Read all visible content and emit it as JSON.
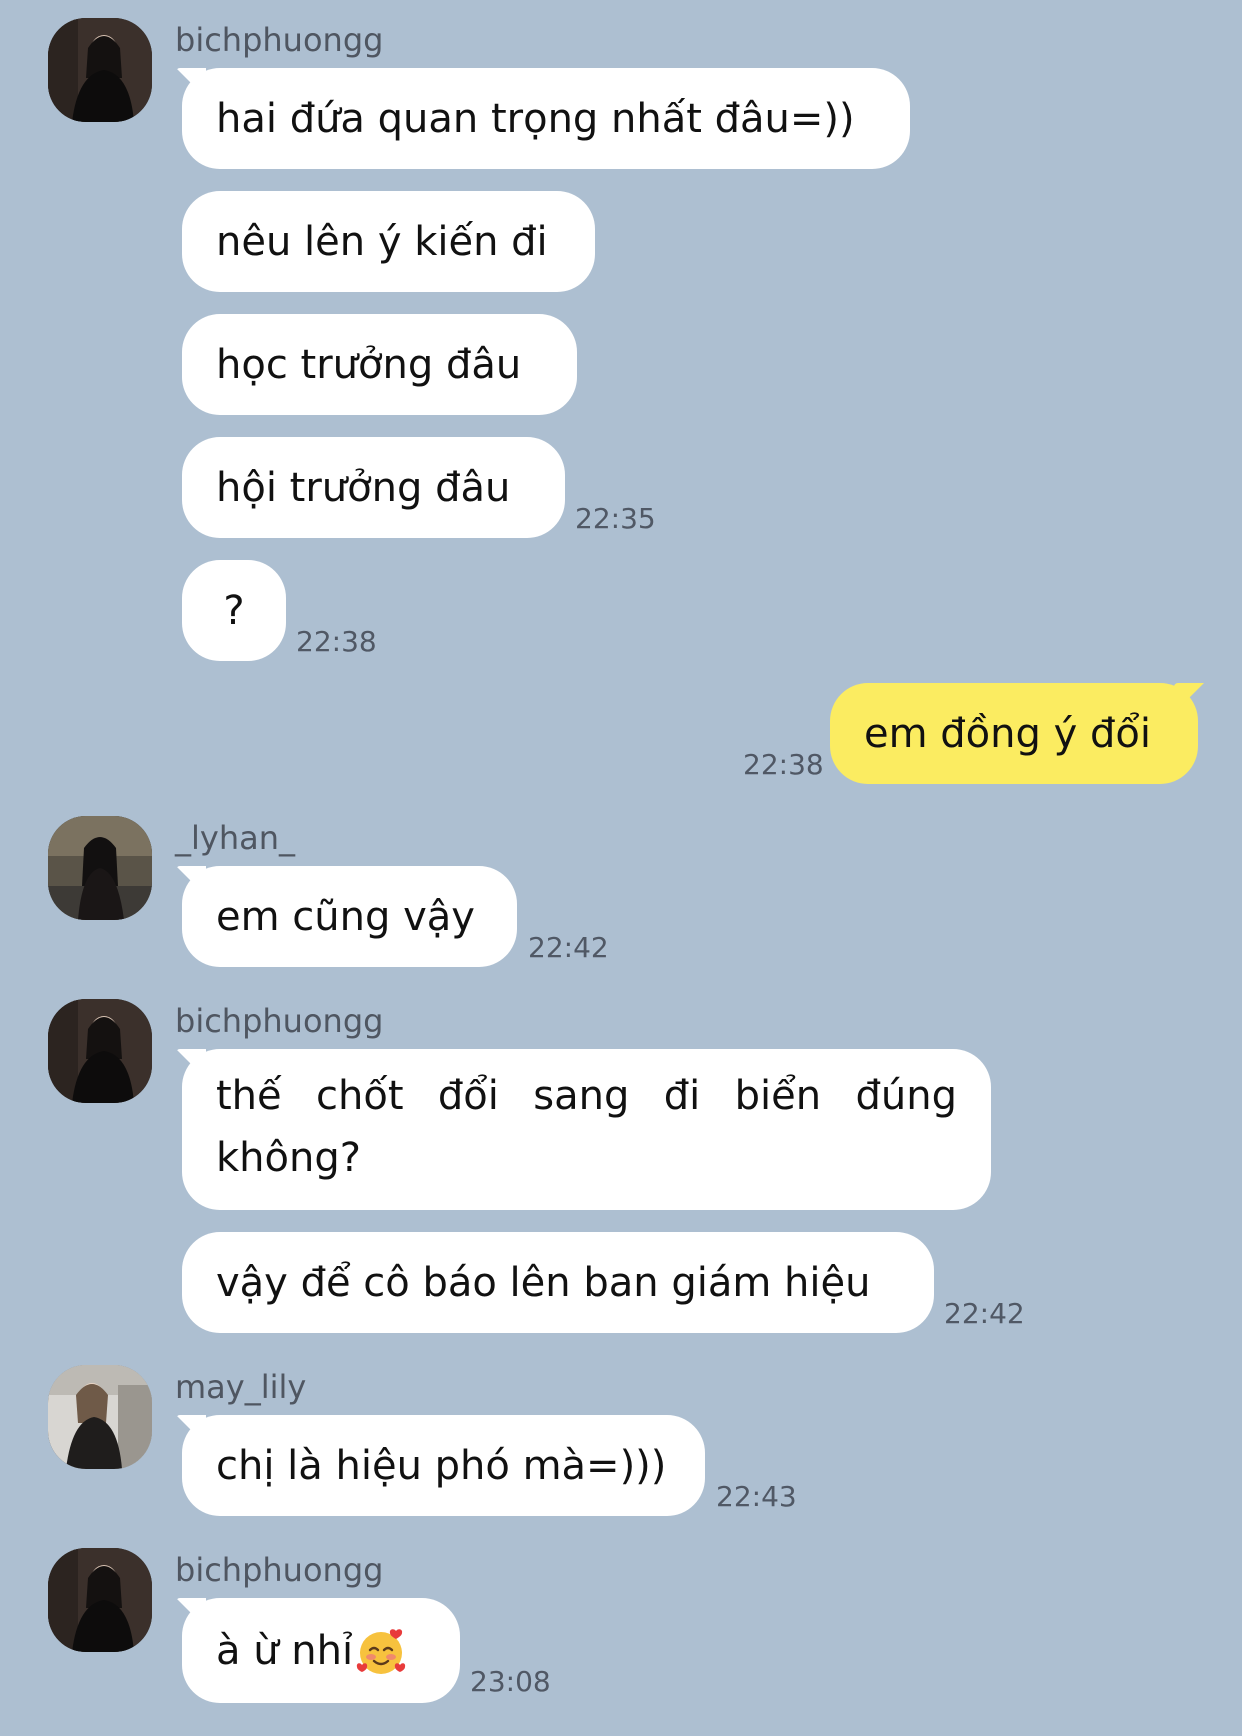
{
  "colors": {
    "background": "#adbfd1",
    "incoming_bubble": "#ffffff",
    "outgoing_bubble": "#fbec61",
    "timestamp": "#505865",
    "sender_name": "#4f5661"
  },
  "messages": [
    {
      "sender": "bichphuongg",
      "texts": [
        "hai đứa quan trọng nhất đâu=))",
        "nêu lên ý kiến đi",
        "học trưởng đâu",
        "hội trưởng đâu"
      ],
      "time": "22:35"
    },
    {
      "text": "?",
      "time": "22:38"
    },
    {
      "outgoing": true,
      "text": "em đồng ý đổi",
      "time": "22:38"
    },
    {
      "sender": "_lyhan_",
      "text": "em cũng vậy",
      "time": "22:42"
    },
    {
      "sender": "bichphuongg",
      "texts": [
        "thế chốt đổi sang đi biển đúng không?",
        "vậy để cô báo lên ban giám hiệu"
      ],
      "time": "22:42"
    },
    {
      "sender": "may_lily",
      "text": "chị là hiệu phó mà=)))",
      "time": "22:43"
    },
    {
      "sender": "bichphuongg",
      "text": "à ừ nhỉ",
      "emoji": "smiling-face-with-hearts-icon",
      "time": "23:08"
    }
  ],
  "multiline_words": {
    "line1": [
      "thế",
      "chốt",
      "đổi",
      "sang",
      "đi",
      "biển",
      "đúng"
    ],
    "line2": "không?"
  }
}
